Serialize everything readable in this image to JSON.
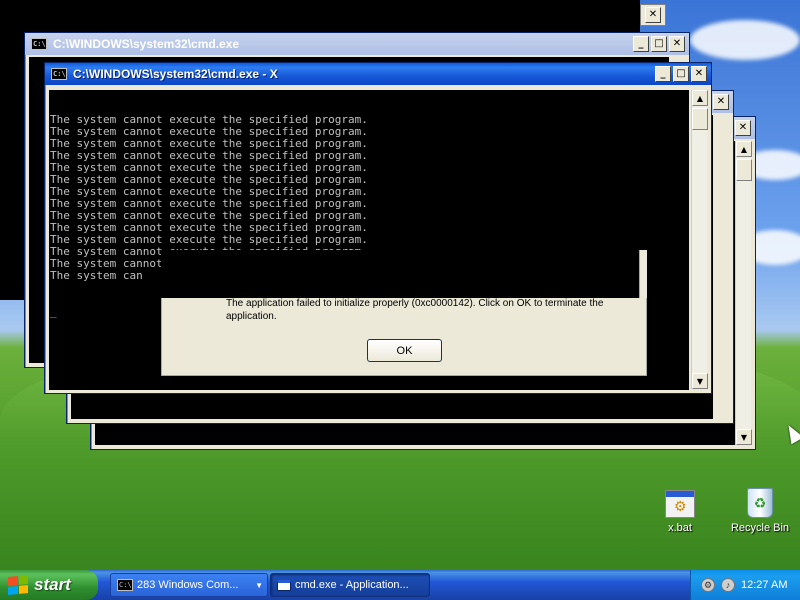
{
  "windows": {
    "back_left": {
      "title": "C:\\WINDOWS\\system32\\cmd.exe"
    },
    "front": {
      "title": "C:\\WINDOWS\\system32\\cmd.exe - X"
    },
    "controls": {
      "min": "_",
      "max": "□",
      "close": "✕"
    }
  },
  "console": {
    "lines": [
      "The system cannot execute the specified program.",
      "The system cannot execute the specified program.",
      "The system cannot execute the specified program.",
      "The system cannot execute the specified program.",
      "The system cannot execute the specified program.",
      "The system cannot execute the specified program.",
      "The system cannot execute the specified program.",
      "The system cannot execute the specified program.",
      "The system cannot execute the specified program.",
      "The system cannot execute the specified program.",
      "The system cannot execute the specified program.",
      "The system cannot execute the specified program.",
      "The system cannot execute the specified program.",
      "The system can"
    ],
    "cursor": "_"
  },
  "dialog": {
    "message": "The application failed to initialize properly (0xc0000142). Click on OK to terminate the application.",
    "ok_label": "OK"
  },
  "desktop_icons": [
    {
      "label": "x.bat",
      "icon": "batch-file-icon"
    },
    {
      "label": "Recycle Bin",
      "icon": "recycle-bin-icon"
    }
  ],
  "taskbar": {
    "start_label": "start",
    "tasks": [
      {
        "label": "283 Windows Com...",
        "icon": "cmd-icon",
        "grouped": true
      },
      {
        "label": "cmd.exe - Application...",
        "icon": "window-icon",
        "active": true
      }
    ],
    "clock": "12:27 AM"
  },
  "colors": {
    "console_bg": "#000000",
    "console_fg": "#c0c0c0",
    "title_active": "#0b46c4",
    "taskbar": "#2157d7",
    "start": "#2f8f2f"
  }
}
